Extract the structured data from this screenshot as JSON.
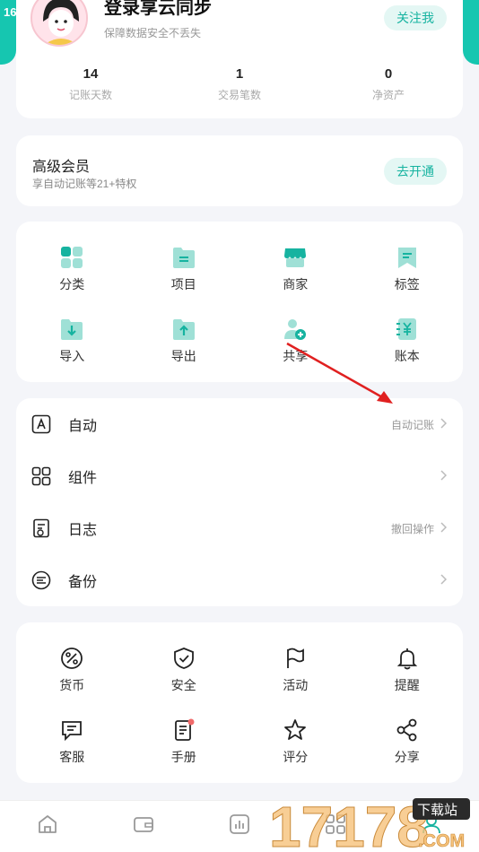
{
  "status_bar": {
    "time": "16"
  },
  "profile": {
    "username": "登录享云同步",
    "subtitle": "保障数据安全不丢失",
    "follow_label": "关注我",
    "stats": [
      {
        "value": "14",
        "label": "记账天数"
      },
      {
        "value": "1",
        "label": "交易笔数"
      },
      {
        "value": "0",
        "label": "净资产"
      }
    ]
  },
  "vip": {
    "title": "高级会员",
    "subtitle": "享自动记账等21+特权",
    "button_label": "去开通"
  },
  "tools": [
    {
      "label": "分类",
      "icon": "category-icon"
    },
    {
      "label": "项目",
      "icon": "folder-icon"
    },
    {
      "label": "商家",
      "icon": "shop-icon"
    },
    {
      "label": "标签",
      "icon": "tag-icon"
    },
    {
      "label": "导入",
      "icon": "import-icon"
    },
    {
      "label": "导出",
      "icon": "export-icon"
    },
    {
      "label": "共享",
      "icon": "share-user-icon"
    },
    {
      "label": "账本",
      "icon": "ledger-icon"
    }
  ],
  "list": [
    {
      "label": "自动",
      "hint": "自动记账",
      "icon": "auto-icon"
    },
    {
      "label": "组件",
      "hint": "",
      "icon": "widget-icon"
    },
    {
      "label": "日志",
      "hint": "撤回操作",
      "icon": "log-icon"
    },
    {
      "label": "备份",
      "hint": "",
      "icon": "backup-icon"
    }
  ],
  "more": [
    {
      "label": "货币",
      "icon": "currency-icon"
    },
    {
      "label": "安全",
      "icon": "shield-icon"
    },
    {
      "label": "活动",
      "icon": "flag-icon"
    },
    {
      "label": "提醒",
      "icon": "bell-icon"
    },
    {
      "label": "客服",
      "icon": "chat-icon"
    },
    {
      "label": "手册",
      "icon": "manual-icon"
    },
    {
      "label": "评分",
      "icon": "star-icon"
    },
    {
      "label": "分享",
      "icon": "share-icon"
    }
  ],
  "colors": {
    "accent": "#16c6b0",
    "accent_light": "#e4f7f4",
    "arrow": "#e02020"
  },
  "watermark": {
    "text": "17178",
    "badge": "下载站",
    "domain": ".COM"
  }
}
